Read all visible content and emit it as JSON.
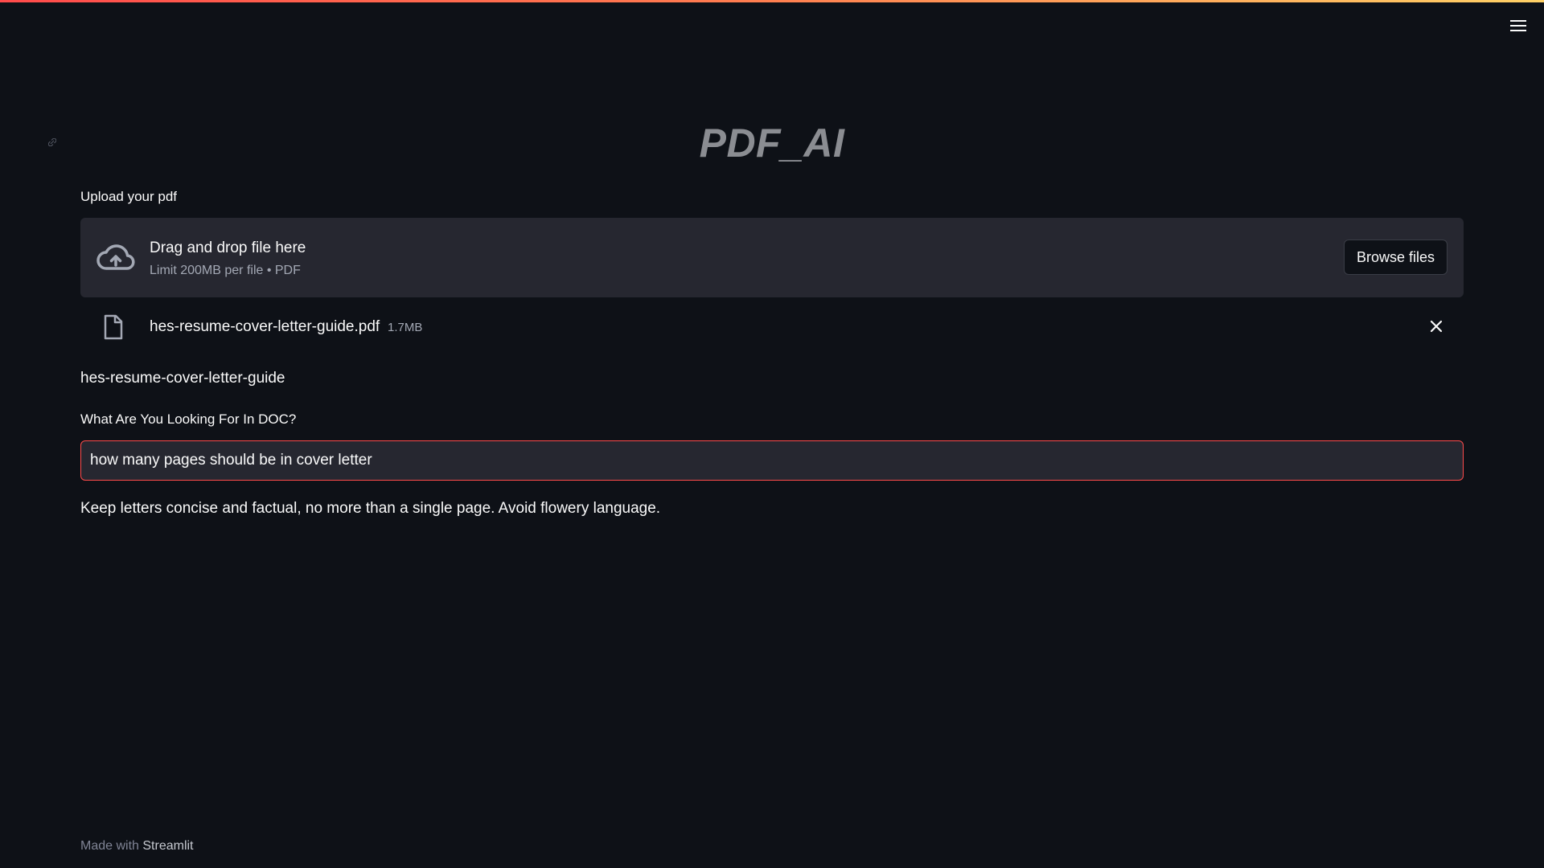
{
  "app": {
    "title": "PDF_AI"
  },
  "upload": {
    "label": "Upload your pdf",
    "dropzone_title": "Drag and drop file here",
    "dropzone_subtitle": "Limit 200MB per file • PDF",
    "browse_label": "Browse files",
    "file": {
      "name": "hes-resume-cover-letter-guide.pdf",
      "size": "1.7MB"
    }
  },
  "document": {
    "name": "hes-resume-cover-letter-guide"
  },
  "query": {
    "label": "What Are You Looking For In DOC?",
    "value": "how many pages should be in cover letter"
  },
  "answer": {
    "text": "Keep letters concise and factual, no more than a single page. Avoid flowery language."
  },
  "footer": {
    "prefix": "Made with",
    "brand": "Streamlit"
  },
  "icons": {
    "menu": "hamburger-menu-icon",
    "upload": "cloud-upload-icon",
    "file": "file-icon",
    "close": "close-icon",
    "anchor": "link-icon"
  },
  "colors": {
    "background": "#0e1117",
    "panel": "#262730",
    "accent": "#ff4b4b",
    "title": "#8b8d92"
  }
}
